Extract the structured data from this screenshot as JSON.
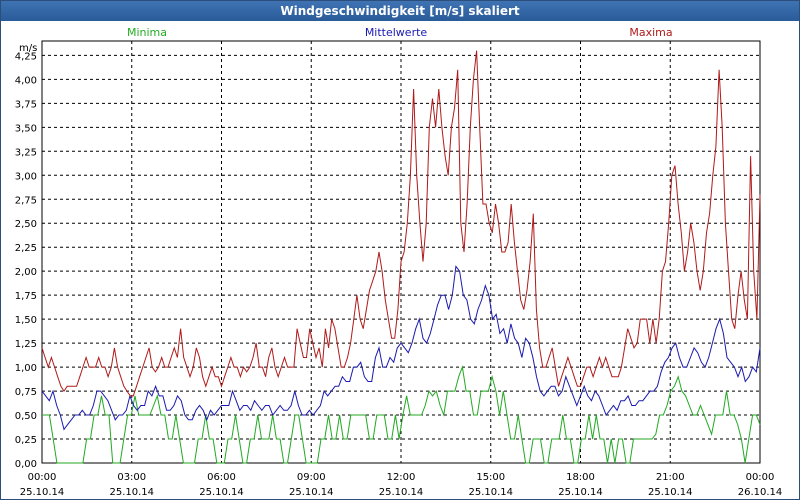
{
  "window": {
    "title": "Windgeschwindigkeit [m/s] skaliert"
  },
  "chart_data": {
    "type": "line",
    "title": "Windgeschwindigkeit [m/s] skaliert",
    "ylabel": "m/s",
    "ylim": [
      0,
      4.4
    ],
    "y_ticks": [
      "0,00",
      "0,25",
      "0,50",
      "0,75",
      "1,00",
      "1,25",
      "1,50",
      "1,75",
      "2,00",
      "2,25",
      "2,50",
      "2,75",
      "3,00",
      "3,25",
      "3,50",
      "3,75",
      "4,00",
      "4,25"
    ],
    "x_ticks": [
      {
        "time": "00:00",
        "date": "25.10.14"
      },
      {
        "time": "03:00",
        "date": "25.10.14"
      },
      {
        "time": "06:00",
        "date": "25.10.14"
      },
      {
        "time": "09:00",
        "date": "25.10.14"
      },
      {
        "time": "12:00",
        "date": "25.10.14"
      },
      {
        "time": "15:00",
        "date": "25.10.14"
      },
      {
        "time": "18:00",
        "date": "25.10.14"
      },
      {
        "time": "21:00",
        "date": "25.10.14"
      },
      {
        "time": "00:00",
        "date": "26.10.14"
      }
    ],
    "grid": true,
    "legend_position": "top",
    "series": [
      {
        "name": "Minima",
        "color": "#22aa22",
        "values": [
          0.5,
          0.5,
          0.5,
          0.25,
          0.0,
          0.0,
          0.0,
          0.0,
          0.0,
          0.0,
          0.0,
          0.0,
          0.25,
          0.25,
          0.5,
          0.5,
          0.7,
          0.5,
          0.5,
          0.0,
          0.0,
          0.0,
          0.25,
          0.5,
          0.5,
          0.7,
          0.5,
          0.5,
          0.5,
          0.5,
          0.6,
          0.7,
          0.5,
          0.5,
          0.25,
          0.25,
          0.5,
          0.25,
          0.0,
          0.0,
          0.0,
          0.0,
          0.25,
          0.25,
          0.5,
          0.25,
          0.25,
          0.0,
          0.0,
          0.0,
          0.25,
          0.25,
          0.5,
          0.25,
          0.0,
          0.0,
          0.25,
          0.25,
          0.5,
          0.25,
          0.25,
          0.25,
          0.5,
          0.25,
          0.25,
          0.0,
          0.0,
          0.25,
          0.5,
          0.5,
          0.25,
          0.0,
          0.0,
          0.0,
          0.0,
          0.25,
          0.25,
          0.5,
          0.25,
          0.25,
          0.5,
          0.25,
          0.25,
          0.5,
          0.5,
          0.5,
          0.5,
          0.5,
          0.25,
          0.25,
          0.5,
          0.5,
          0.5,
          0.25,
          0.25,
          0.5,
          0.25,
          0.5,
          0.7,
          0.5,
          0.5,
          0.5,
          0.5,
          0.6,
          0.75,
          0.7,
          0.75,
          0.6,
          0.5,
          0.75,
          0.75,
          0.75,
          0.9,
          1.0,
          0.75,
          0.75,
          0.5,
          0.5,
          0.75,
          0.75,
          0.75,
          0.9,
          0.75,
          0.5,
          0.75,
          0.5,
          0.25,
          0.25,
          0.5,
          0.25,
          0.0,
          0.0,
          0.25,
          0.25,
          0.25,
          0.0,
          0.0,
          0.25,
          0.25,
          0.25,
          0.5,
          0.25,
          0.25,
          0.0,
          0.0,
          0.25,
          0.25,
          0.5,
          0.25,
          0.5,
          0.25,
          0.25,
          0.0,
          0.25,
          0.0,
          0.25,
          0.25,
          0.0,
          0.0,
          0.25,
          0.25,
          0.25,
          0.25,
          0.25,
          0.25,
          0.3,
          0.5,
          0.5,
          0.6,
          0.75,
          0.8,
          0.9,
          0.75,
          0.7,
          0.6,
          0.5,
          0.5,
          0.6,
          0.5,
          0.4,
          0.3,
          0.5,
          0.5,
          0.5,
          0.75,
          0.5,
          0.5,
          0.4,
          0.25,
          0.0,
          0.25,
          0.5,
          0.5,
          0.4
        ]
      },
      {
        "name": "Mittelwerte",
        "color": "#1a1ab0",
        "values": [
          0.75,
          0.7,
          0.65,
          0.75,
          0.6,
          0.5,
          0.35,
          0.4,
          0.45,
          0.5,
          0.5,
          0.55,
          0.5,
          0.5,
          0.6,
          0.75,
          0.75,
          0.7,
          0.65,
          0.55,
          0.45,
          0.5,
          0.5,
          0.55,
          0.7,
          0.6,
          0.55,
          0.6,
          0.6,
          0.75,
          0.7,
          0.8,
          0.7,
          0.7,
          0.55,
          0.55,
          0.6,
          0.7,
          0.65,
          0.5,
          0.45,
          0.45,
          0.55,
          0.6,
          0.55,
          0.45,
          0.55,
          0.5,
          0.55,
          0.6,
          0.6,
          0.6,
          0.75,
          0.65,
          0.55,
          0.6,
          0.6,
          0.55,
          0.65,
          0.6,
          0.55,
          0.6,
          0.6,
          0.5,
          0.55,
          0.6,
          0.55,
          0.55,
          0.6,
          0.75,
          0.6,
          0.5,
          0.5,
          0.55,
          0.5,
          0.55,
          0.6,
          0.75,
          0.7,
          0.75,
          0.8,
          0.8,
          0.9,
          0.85,
          0.85,
          1.0,
          1.0,
          1.05,
          0.9,
          0.85,
          0.85,
          1.1,
          1.2,
          1.0,
          1.0,
          1.1,
          1.05,
          1.2,
          1.25,
          1.2,
          1.15,
          1.25,
          1.4,
          1.5,
          1.3,
          1.25,
          1.35,
          1.5,
          1.65,
          1.75,
          1.75,
          1.6,
          1.75,
          2.05,
          2.0,
          1.75,
          1.7,
          1.5,
          1.45,
          1.6,
          1.7,
          1.85,
          1.75,
          1.5,
          1.55,
          1.35,
          1.4,
          1.25,
          1.45,
          1.3,
          1.25,
          1.1,
          1.3,
          1.25,
          1.1,
          0.9,
          0.75,
          0.7,
          0.75,
          0.8,
          0.8,
          0.7,
          0.75,
          0.9,
          0.8,
          0.7,
          0.6,
          0.7,
          0.8,
          0.7,
          0.65,
          0.75,
          0.7,
          0.6,
          0.5,
          0.55,
          0.6,
          0.55,
          0.65,
          0.65,
          0.7,
          0.6,
          0.6,
          0.65,
          0.65,
          0.7,
          0.75,
          0.75,
          0.8,
          0.95,
          1.05,
          1.1,
          1.2,
          1.25,
          1.1,
          1.0,
          1.0,
          1.1,
          1.2,
          1.15,
          1.05,
          1.0,
          1.1,
          1.25,
          1.4,
          1.5,
          1.35,
          1.1,
          1.05,
          1.0,
          0.9,
          1.0,
          0.85,
          0.9,
          1.0,
          0.95,
          1.2
        ]
      },
      {
        "name": "Maxima",
        "color": "#b01a1a",
        "values": [
          1.2,
          1.1,
          1.0,
          1.1,
          1.0,
          0.9,
          0.8,
          0.75,
          0.8,
          0.8,
          0.8,
          0.8,
          0.9,
          1.0,
          1.1,
          1.0,
          1.0,
          1.0,
          1.1,
          1.0,
          1.0,
          0.9,
          1.0,
          1.2,
          1.0,
          0.9,
          0.8,
          0.75,
          0.7,
          0.7,
          0.8,
          0.9,
          1.0,
          1.1,
          1.2,
          1.0,
          0.95,
          1.0,
          1.1,
          1.0,
          1.0,
          1.1,
          1.2,
          1.1,
          1.4,
          1.1,
          1.0,
          0.9,
          1.0,
          1.2,
          1.1,
          0.9,
          0.8,
          0.9,
          1.0,
          0.9,
          0.9,
          0.8,
          0.9,
          1.0,
          1.1,
          1.0,
          1.0,
          0.9,
          1.0,
          0.95,
          1.0,
          1.1,
          1.25,
          1.0,
          1.0,
          0.9,
          1.1,
          1.2,
          1.0,
          0.9,
          1.0,
          1.1,
          1.0,
          1.0,
          1.0,
          1.4,
          1.25,
          1.1,
          1.1,
          1.4,
          1.25,
          1.1,
          1.2,
          1.0,
          1.4,
          1.2,
          1.5,
          1.4,
          1.2,
          1.0,
          1.0,
          1.1,
          1.25,
          1.5,
          1.75,
          1.5,
          1.4,
          1.6,
          1.8,
          1.9,
          2.0,
          2.2,
          2.0,
          1.7,
          1.5,
          1.3,
          1.3,
          1.6,
          2.1,
          2.2,
          2.5,
          3.0,
          3.9,
          3.0,
          2.5,
          2.1,
          2.5,
          3.5,
          3.8,
          3.5,
          3.9,
          3.5,
          3.2,
          3.0,
          3.5,
          3.7,
          4.1,
          2.5,
          2.2,
          2.7,
          3.5,
          4.0,
          4.3,
          3.5,
          2.7,
          2.7,
          2.5,
          2.4,
          2.7,
          2.5,
          2.2,
          2.2,
          2.3,
          2.7,
          2.3,
          2.0,
          1.7,
          1.6,
          1.8,
          2.1,
          2.6,
          1.6,
          1.2,
          1.0,
          1.0,
          1.1,
          1.2,
          1.0,
          0.8,
          0.9,
          1.0,
          1.1,
          1.0,
          0.9,
          0.8,
          0.8,
          0.9,
          1.0,
          1.0,
          0.9,
          1.0,
          1.1,
          1.0,
          1.1,
          1.0,
          0.9,
          0.9,
          0.9,
          1.0,
          1.2,
          1.4,
          1.3,
          1.2,
          1.25,
          1.5,
          1.5,
          1.5,
          1.25,
          1.5,
          1.25,
          1.5,
          2.0,
          2.1,
          2.5,
          3.0,
          3.1,
          2.7,
          2.4,
          2.0,
          2.2,
          2.5,
          2.3,
          2.0,
          1.8,
          2.0,
          2.4,
          2.6,
          3.0,
          3.3,
          4.1,
          3.5,
          2.5,
          2.0,
          1.5,
          1.4,
          1.75,
          2.0,
          1.7,
          1.5,
          3.2,
          2.0,
          1.5,
          2.8
        ]
      }
    ]
  }
}
